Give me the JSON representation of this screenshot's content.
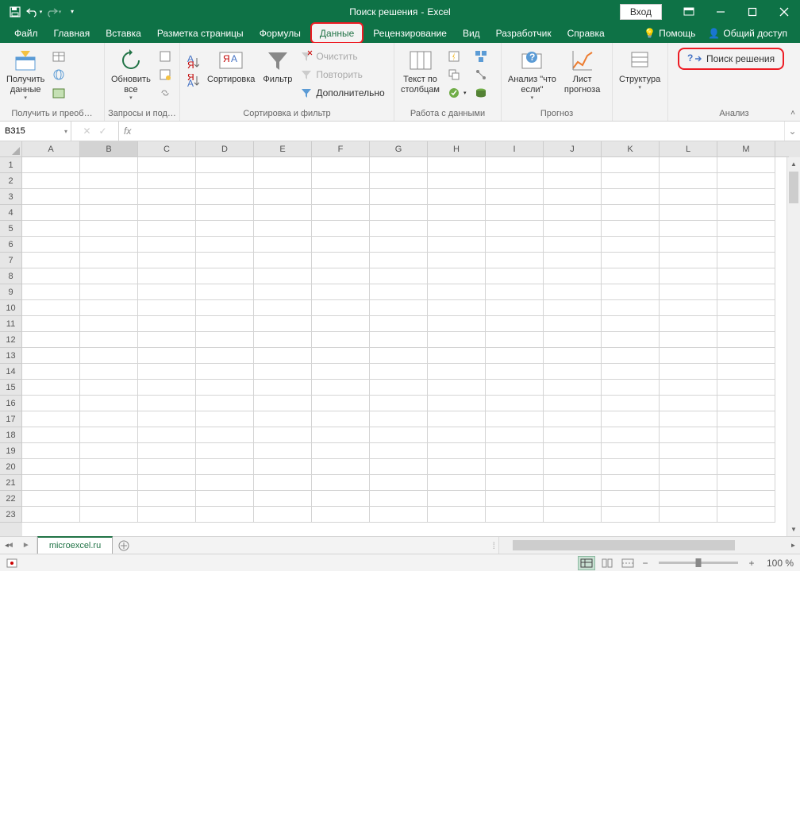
{
  "title": {
    "doc": "Поиск решения",
    "sep": "-",
    "app": "Excel"
  },
  "login": "Вход",
  "tabs": [
    "Файл",
    "Главная",
    "Вставка",
    "Разметка страницы",
    "Формулы",
    "Данные",
    "Рецензирование",
    "Вид",
    "Разработчик",
    "Справка"
  ],
  "active_tab_index": 5,
  "highlighted_tab_index": 5,
  "help": {
    "ask": "Помощь",
    "share": "Общий доступ"
  },
  "ribbon": {
    "groups": [
      {
        "label": "Получить и преоб…"
      },
      {
        "label": "Запросы и под…"
      },
      {
        "label": "Сортировка и фильтр"
      },
      {
        "label": "Работа с данными"
      },
      {
        "label": "Прогноз"
      },
      {
        "label": "Анализ"
      }
    ],
    "get_data": "Получить\nданные",
    "refresh": "Обновить\nвсе",
    "sort": "Сортировка",
    "filter": "Фильтр",
    "clear": "Очистить",
    "reapply": "Повторить",
    "advanced": "Дополнительно",
    "text_cols": "Текст по\nстолбцам",
    "what_if": "Анализ \"что\nесли\"",
    "forecast": "Лист\nпрогноза",
    "outline": "Структура",
    "solver": "Поиск решения"
  },
  "namebox": "B315",
  "fx": "fx",
  "columns": [
    "A",
    "B",
    "C",
    "D",
    "E",
    "F",
    "G",
    "H",
    "I",
    "J",
    "K",
    "L",
    "M"
  ],
  "rows": [
    "1",
    "2",
    "3",
    "4",
    "5",
    "6",
    "7",
    "8",
    "9",
    "10",
    "11",
    "12",
    "13",
    "14",
    "15",
    "16",
    "17",
    "18",
    "19",
    "20",
    "21",
    "22",
    "23"
  ],
  "selected_col_index": 1,
  "sheet": "microexcel.ru",
  "zoom": "100 %"
}
